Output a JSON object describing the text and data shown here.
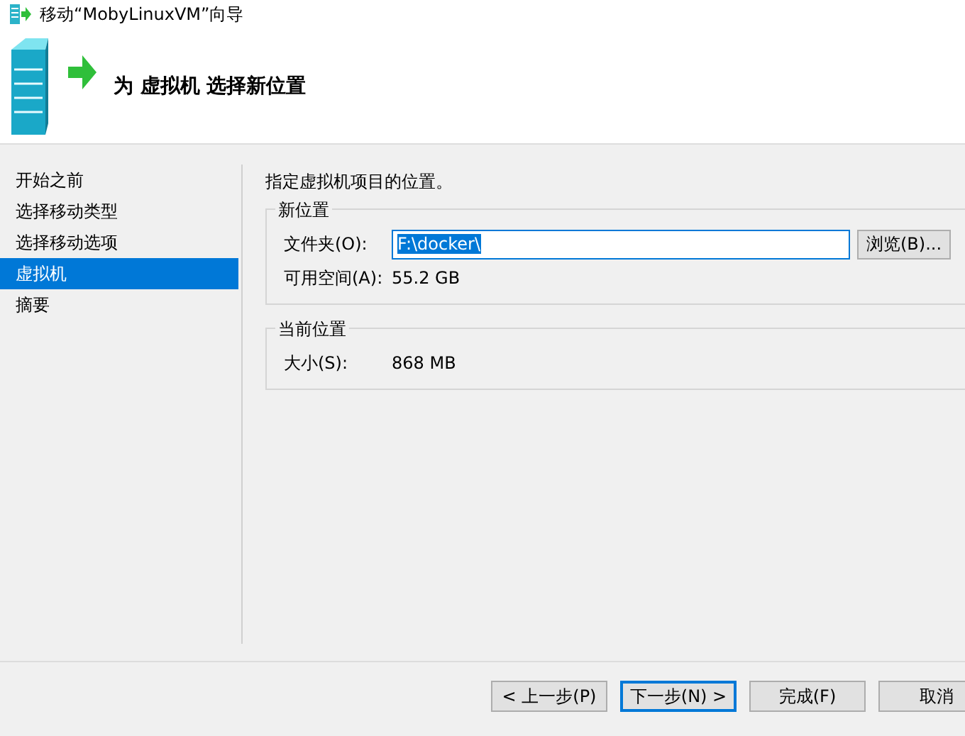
{
  "window": {
    "title": "移动“MobyLinuxVM”向导"
  },
  "header": {
    "title": "为 虚拟机 选择新位置"
  },
  "sidebar": {
    "items": [
      {
        "label": "开始之前",
        "selected": false
      },
      {
        "label": "选择移动类型",
        "selected": false
      },
      {
        "label": "选择移动选项",
        "selected": false
      },
      {
        "label": "虚拟机",
        "selected": true
      },
      {
        "label": "摘要",
        "selected": false
      }
    ]
  },
  "instruction": "指定虚拟机项目的位置。",
  "new_location": {
    "title": "新位置",
    "folder_label": "文件夹(O):",
    "folder_value": "F:\\docker\\",
    "browse_button": "浏览(B)...",
    "space_label": "可用空间(A):",
    "space_value": "55.2 GB"
  },
  "current_location": {
    "title": "当前位置",
    "size_label": "大小(S):",
    "size_value": "868 MB"
  },
  "buttons": [
    {
      "label": "< 上一步(P)",
      "default": false
    },
    {
      "label": "下一步(N) >",
      "default": true
    },
    {
      "label": "完成(F)",
      "default": false
    },
    {
      "label": "取消",
      "default": false
    }
  ]
}
